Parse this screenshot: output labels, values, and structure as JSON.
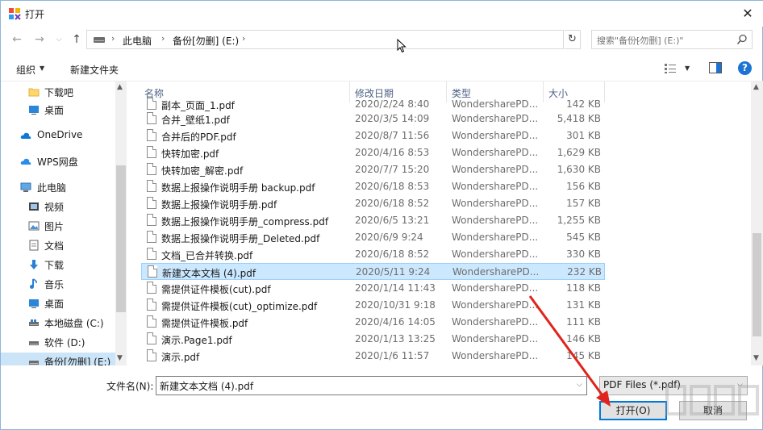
{
  "window": {
    "title": "打开",
    "accent_color": "#0078d7"
  },
  "address": {
    "crumbs": [
      "此电脑",
      "备份[勿删] (E:)"
    ],
    "search_placeholder": "搜索\"备份[勿删] (E:)\""
  },
  "toolbar": {
    "organize_label": "组织",
    "new_folder_label": "新建文件夹"
  },
  "sidebar": {
    "items": [
      {
        "label": "下载吧",
        "icon": "folder-icon"
      },
      {
        "label": "桌面",
        "icon": "desktop-icon"
      },
      {
        "label": "OneDrive",
        "icon": "cloud-icon"
      },
      {
        "label": "WPS网盘",
        "icon": "wps-cloud-icon"
      },
      {
        "label": "此电脑",
        "icon": "computer-icon"
      },
      {
        "label": "视频",
        "icon": "video-icon"
      },
      {
        "label": "图片",
        "icon": "picture-icon"
      },
      {
        "label": "文档",
        "icon": "document-icon"
      },
      {
        "label": "下载",
        "icon": "download-icon"
      },
      {
        "label": "音乐",
        "icon": "music-icon"
      },
      {
        "label": "桌面",
        "icon": "desktop-icon"
      },
      {
        "label": "本地磁盘 (C:)",
        "icon": "drive-icon"
      },
      {
        "label": "软件 (D:)",
        "icon": "drive-icon"
      },
      {
        "label": "备份[勿删] (E:)",
        "icon": "drive-icon",
        "selected": true
      }
    ]
  },
  "columns": {
    "name": "名称",
    "date": "修改日期",
    "type": "类型",
    "size": "大小"
  },
  "files": [
    {
      "name": "副本_页面_1.pdf",
      "date": "2020/2/24 8:40",
      "type": "WondersharePD...",
      "size": "142 KB"
    },
    {
      "name": "合并_壁纸1.pdf",
      "date": "2020/3/5 14:09",
      "type": "WondersharePD...",
      "size": "5,418 KB"
    },
    {
      "name": "合并后的PDF.pdf",
      "date": "2020/8/7 11:56",
      "type": "WondersharePD...",
      "size": "301 KB"
    },
    {
      "name": "快转加密.pdf",
      "date": "2020/4/16 8:53",
      "type": "WondersharePD...",
      "size": "1,629 KB"
    },
    {
      "name": "快转加密_解密.pdf",
      "date": "2020/7/7 15:20",
      "type": "WondersharePD...",
      "size": "1,630 KB"
    },
    {
      "name": "数据上报操作说明手册 backup.pdf",
      "date": "2020/6/18 8:53",
      "type": "WondersharePD...",
      "size": "156 KB"
    },
    {
      "name": "数据上报操作说明手册.pdf",
      "date": "2020/6/18 8:52",
      "type": "WondersharePD...",
      "size": "157 KB"
    },
    {
      "name": "数据上报操作说明手册_compress.pdf",
      "date": "2020/6/5 13:21",
      "type": "WondersharePD...",
      "size": "1,255 KB"
    },
    {
      "name": "数据上报操作说明手册_Deleted.pdf",
      "date": "2020/6/9 9:24",
      "type": "WondersharePD...",
      "size": "545 KB"
    },
    {
      "name": "文档_已合并转换.pdf",
      "date": "2020/6/18 8:52",
      "type": "WondersharePD...",
      "size": "330 KB"
    },
    {
      "name": "新建文本文档 (4).pdf",
      "date": "2020/5/11 9:24",
      "type": "WondersharePD...",
      "size": "232 KB",
      "selected": true
    },
    {
      "name": "需提供证件模板(cut).pdf",
      "date": "2020/1/14 11:43",
      "type": "WondersharePD...",
      "size": "118 KB"
    },
    {
      "name": "需提供证件模板(cut)_optimize.pdf",
      "date": "2020/10/31 9:18",
      "type": "WondersharePD...",
      "size": "131 KB"
    },
    {
      "name": "需提供证件模板.pdf",
      "date": "2020/4/16 14:05",
      "type": "WondersharePD...",
      "size": "111 KB"
    },
    {
      "name": "演示.Page1.pdf",
      "date": "2020/1/13 13:25",
      "type": "WondersharePD...",
      "size": "146 KB"
    },
    {
      "name": "演示.pdf",
      "date": "2020/1/6 11:57",
      "type": "WondersharePD...",
      "size": "145 KB"
    }
  ],
  "bottom": {
    "filename_label": "文件名(N):",
    "filename_value": "新建文本文档 (4).pdf",
    "filetype_value": "PDF Files (*.pdf)",
    "open_label": "打开(O)",
    "cancel_label": "取消"
  }
}
